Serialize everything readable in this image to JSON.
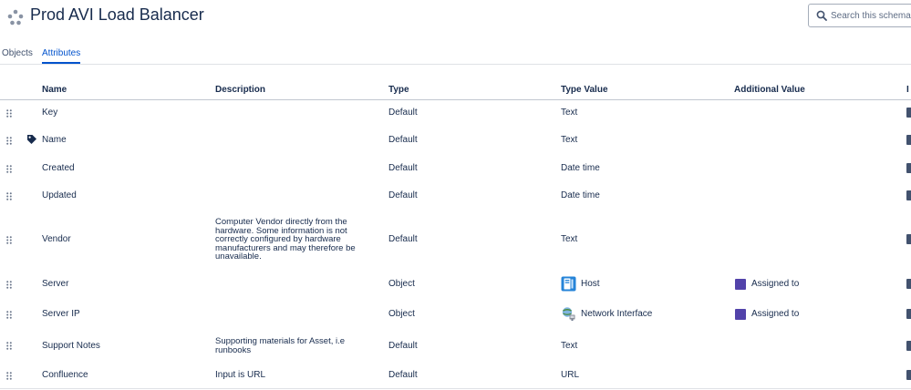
{
  "header": {
    "title": "Prod AVI Load Balancer",
    "search_placeholder": "Search this schema..."
  },
  "tabs": [
    {
      "label": "Objects",
      "active": false
    },
    {
      "label": "Attributes",
      "active": true
    }
  ],
  "table": {
    "columns": [
      "Name",
      "Description",
      "Type",
      "Type Value",
      "Additional Value",
      "I"
    ],
    "rows": [
      {
        "name": "Key",
        "description": "",
        "type": "Default",
        "type_value": "Text",
        "additional_value": ""
      },
      {
        "name": "Name",
        "description": "",
        "type": "Default",
        "type_value": "Text",
        "additional_value": "",
        "label_icon": "tag-icon"
      },
      {
        "name": "Created",
        "description": "",
        "type": "Default",
        "type_value": "Date time",
        "additional_value": ""
      },
      {
        "name": "Updated",
        "description": "",
        "type": "Default",
        "type_value": "Date time",
        "additional_value": ""
      },
      {
        "name": "Vendor",
        "description": "Computer Vendor directly from the hardware. Some information is not correctly configured by hardware manufacturers and may therefore be unavailable.",
        "type": "Default",
        "type_value": "Text",
        "additional_value": ""
      },
      {
        "name": "Server",
        "description": "",
        "type": "Object",
        "type_value": "Host",
        "type_value_icon": "host-icon",
        "additional_value": "Assigned to"
      },
      {
        "name": "Server IP",
        "description": "",
        "type": "Object",
        "type_value": "Network Interface",
        "type_value_icon": "network-interface-icon",
        "additional_value": "Assigned to"
      },
      {
        "name": "Support Notes",
        "description": "Supporting materials for Asset, i.e runbooks",
        "type": "Default",
        "type_value": "Text",
        "additional_value": ""
      },
      {
        "name": "Confluence",
        "description": "Input is URL",
        "type": "Default",
        "type_value": "URL",
        "additional_value": ""
      }
    ]
  },
  "colors": {
    "accent": "#0052cc",
    "assigned_swatch": "#5243aa",
    "text": "#172b4d"
  }
}
